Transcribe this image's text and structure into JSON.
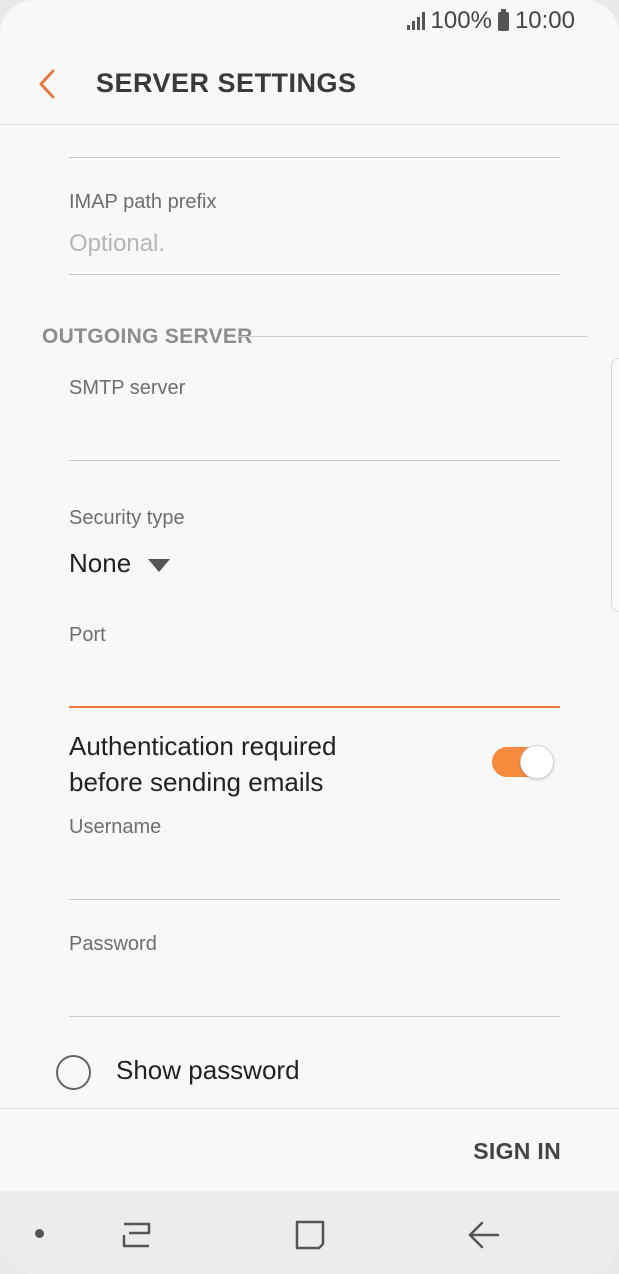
{
  "status_bar": {
    "battery": "100%",
    "time": "10:00"
  },
  "header": {
    "title": "SERVER SETTINGS",
    "back_icon": "chevron-left-icon"
  },
  "incoming": {
    "imap_prefix": {
      "label": "IMAP path prefix",
      "placeholder": "Optional."
    }
  },
  "outgoing": {
    "section_title": "OUTGOING SERVER",
    "smtp": {
      "label": "SMTP server",
      "value": ""
    },
    "security": {
      "label": "Security type",
      "value": "None"
    },
    "port": {
      "label": "Port",
      "value": ""
    },
    "auth": {
      "line1": "Authentication required",
      "line2": "before sending emails",
      "enabled": true
    },
    "username": {
      "label": "Username",
      "value": ""
    },
    "password": {
      "label": "Password",
      "value": ""
    },
    "show_password": {
      "label": "Show password",
      "checked": false
    }
  },
  "footer": {
    "sign_in": "SIGN IN"
  },
  "colors": {
    "accent": "#f68b3e",
    "focus_line": "#e8783e",
    "background": "#f8f8f8"
  },
  "nav": {
    "icons": [
      "dot-icon",
      "recent-apps-icon",
      "home-icon",
      "back-arrow-icon"
    ]
  }
}
